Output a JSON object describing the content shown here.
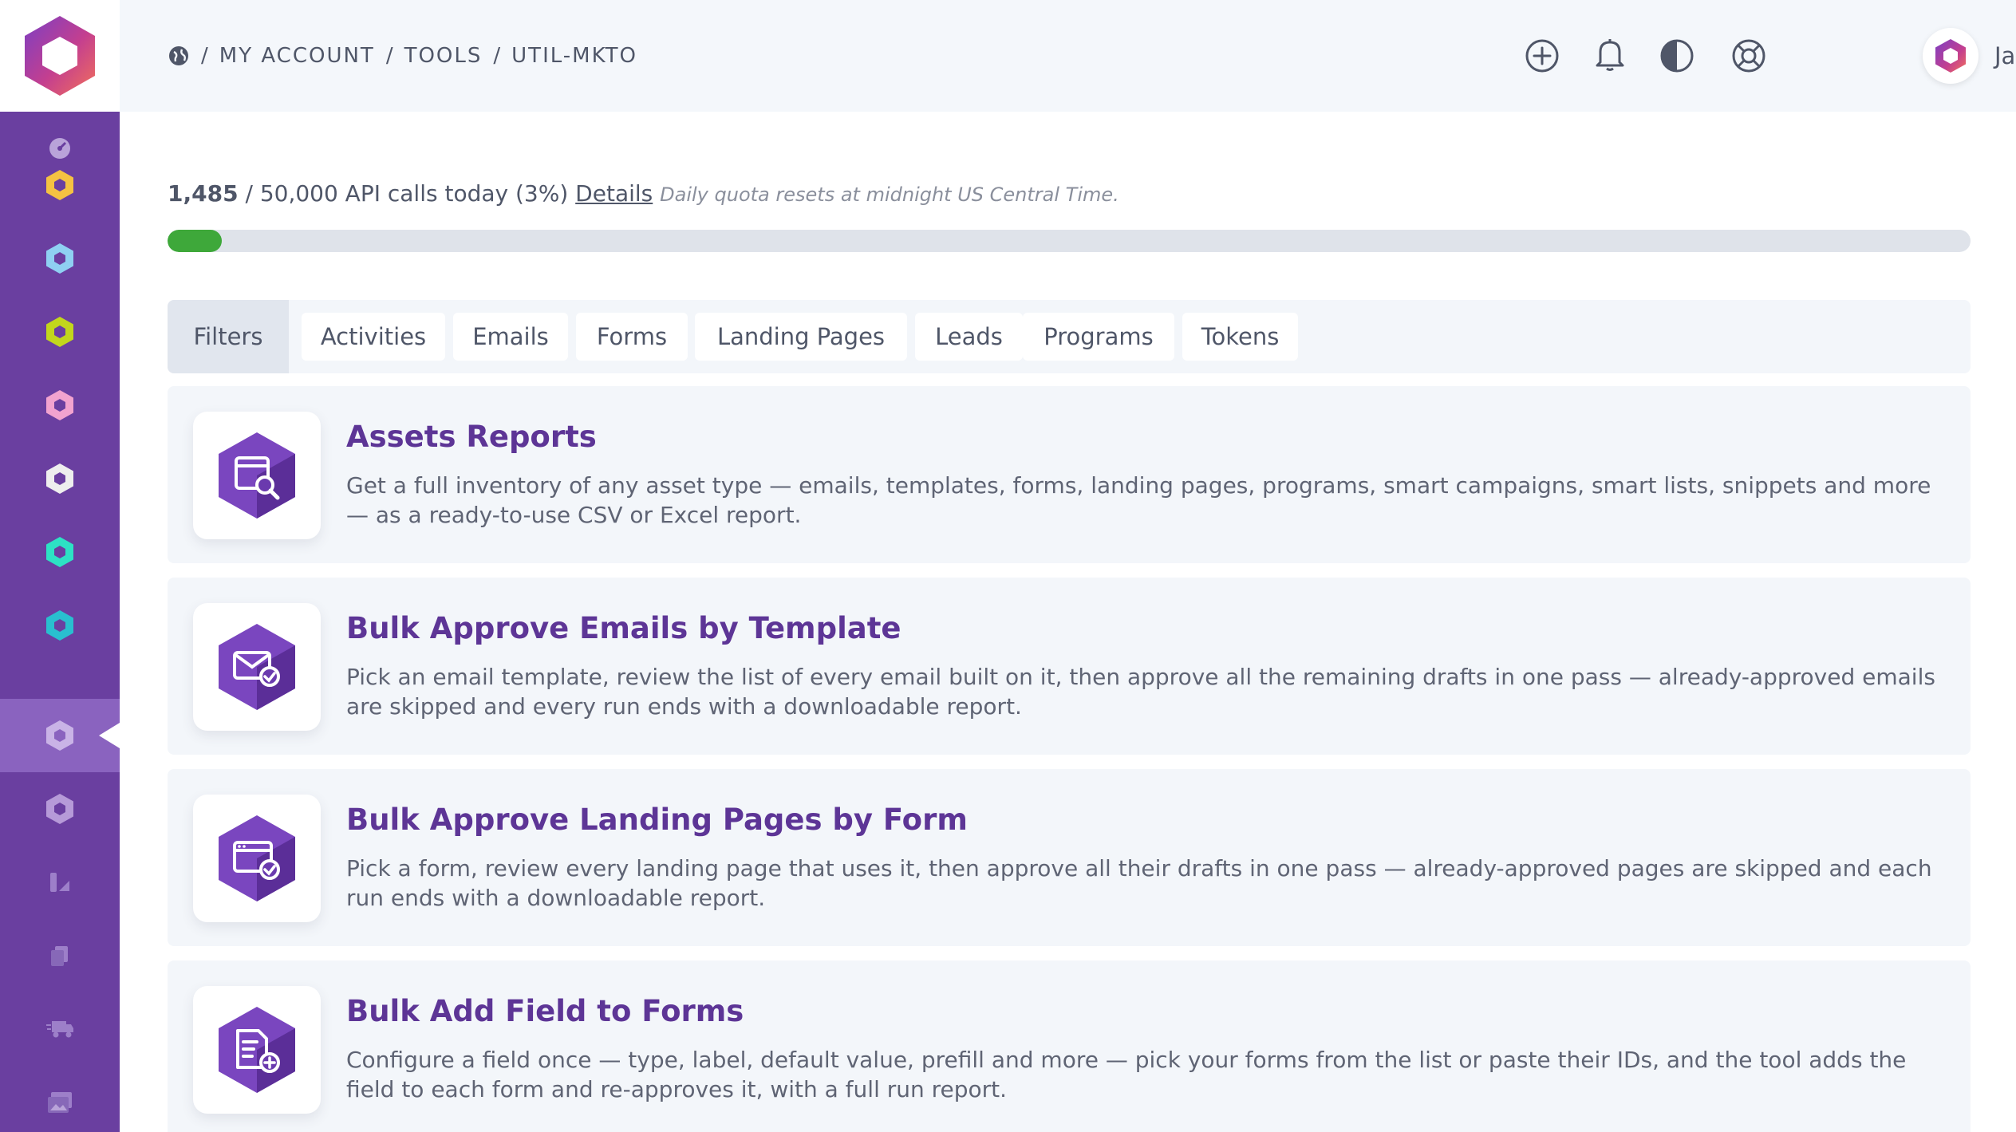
{
  "app": {
    "brand_colors": {
      "sidebar": "#6a3fa0",
      "sidebar_active": "#8a63bf",
      "title": "#5d3596",
      "progress": "#3ea83a"
    },
    "logo_icon": "hexagon-logo-icon"
  },
  "breadcrumb": {
    "home_icon": "globe-icon",
    "items": [
      "MY ACCOUNT",
      "TOOLS",
      "UTIL-MKTO"
    ],
    "separator": "/"
  },
  "topbar": {
    "icons": [
      "add-circle-icon",
      "bell-icon",
      "contrast-icon",
      "lifebuoy-icon"
    ],
    "user": {
      "name": "Jane",
      "avatar_icon": "hexagon-avatar-icon",
      "menu_icon": "chevron-down-icon"
    }
  },
  "sidebar": {
    "items": [
      {
        "name": "dashboard-icon"
      },
      {
        "name": "hexagon-yellow-icon",
        "color": "#f5c242"
      },
      {
        "name": "hexagon-lightblue-icon",
        "color": "#8fd0f2"
      },
      {
        "name": "hexagon-lime-icon",
        "color": "#c2d61c"
      },
      {
        "name": "hexagon-pink-icon",
        "color": "#f2a3cf"
      },
      {
        "name": "hexagon-white-icon",
        "color": "#eeeeee"
      },
      {
        "name": "hexagon-teal-icon",
        "color": "#2de2c4"
      },
      {
        "name": "hexagon-cyan-icon",
        "color": "#29bfcf"
      },
      {
        "name": "hexagon-active-icon",
        "color": "#c9b3e6",
        "active": true
      },
      {
        "name": "hexagon-muted-icon",
        "color": "#b69ad8"
      },
      {
        "name": "design-tools-icon"
      },
      {
        "name": "copy-icon"
      },
      {
        "name": "delivery-truck-icon"
      },
      {
        "name": "image-gallery-icon"
      }
    ]
  },
  "quota": {
    "used": "1,485",
    "rest": " / 50,000 API calls today (3%) ",
    "details_link": "Details",
    "note": "Daily quota resets at midnight US Central Time.",
    "percent": 3
  },
  "tabs": [
    {
      "label": "Filters",
      "active": true
    },
    {
      "label": "Activities"
    },
    {
      "label": "Emails"
    },
    {
      "label": "Forms"
    },
    {
      "label": "Landing Pages"
    },
    {
      "label": "Leads"
    },
    {
      "label": "Programs"
    },
    {
      "label": "Tokens"
    }
  ],
  "tools": [
    {
      "title": "Assets Reports",
      "description": "Get a full inventory of any asset type — emails, templates, forms, landing pages, programs, smart campaigns, smart lists, snippets and more — as a ready-to-use CSV or Excel report.",
      "icon": "asset-search-icon"
    },
    {
      "title": "Bulk Approve Emails by Template",
      "description": "Pick an email template, review the list of every email built on it, then approve all the remaining drafts in one pass — already-approved emails are skipped and every run ends with a downloadable report.",
      "icon": "email-approve-icon"
    },
    {
      "title": "Bulk Approve Landing Pages by Form",
      "description": "Pick a form, review every landing page that uses it, then approve all their drafts in one pass — already-approved pages are skipped and each run ends with a downloadable report.",
      "icon": "page-approve-icon"
    },
    {
      "title": "Bulk Add Field to Forms",
      "description": "Configure a field once — type, label, default value, prefill and more — pick your forms from the list or paste their IDs, and the tool adds the field to each form and re-approves it, with a full run report.",
      "icon": "form-add-field-icon"
    }
  ]
}
